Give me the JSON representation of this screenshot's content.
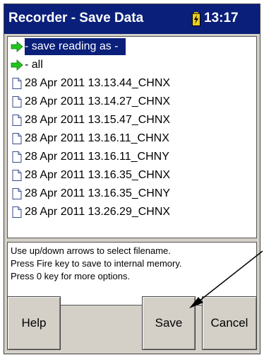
{
  "header": {
    "title": "Recorder - Save Data",
    "time": "13:17"
  },
  "list": {
    "items": [
      {
        "label": "- save reading as -",
        "icon": "green-arrow-icon",
        "selected": true
      },
      {
        "label": "- all",
        "icon": "green-arrow-icon",
        "selected": false
      },
      {
        "label": "28 Apr 2011 13.13.44_CHNX",
        "icon": "document-icon",
        "selected": false
      },
      {
        "label": "28 Apr 2011 13.14.27_CHNX",
        "icon": "document-icon",
        "selected": false
      },
      {
        "label": "28 Apr 2011 13.15.47_CHNX",
        "icon": "document-icon",
        "selected": false
      },
      {
        "label": "28 Apr 2011 13.16.11_CHNX",
        "icon": "document-icon",
        "selected": false
      },
      {
        "label": "28 Apr 2011 13.16.11_CHNY",
        "icon": "document-icon",
        "selected": false
      },
      {
        "label": "28 Apr 2011 13.16.35_CHNX",
        "icon": "document-icon",
        "selected": false
      },
      {
        "label": "28 Apr 2011 13.16.35_CHNY",
        "icon": "document-icon",
        "selected": false
      },
      {
        "label": "28 Apr 2011 13.26.29_CHNX",
        "icon": "document-icon",
        "selected": false
      }
    ]
  },
  "info": {
    "lines": [
      "Use up/down arrows to select filename.",
      "Press Fire key to save to internal memory.",
      "Press 0 key for more options."
    ]
  },
  "buttons": {
    "help": "Help",
    "save": "Save",
    "cancel": "Cancel"
  },
  "colors": {
    "titlebar": "#0a1f7a",
    "selection": "#0a1f7a",
    "arrow_icon": "#22c41e",
    "battery": "#e8d020"
  }
}
